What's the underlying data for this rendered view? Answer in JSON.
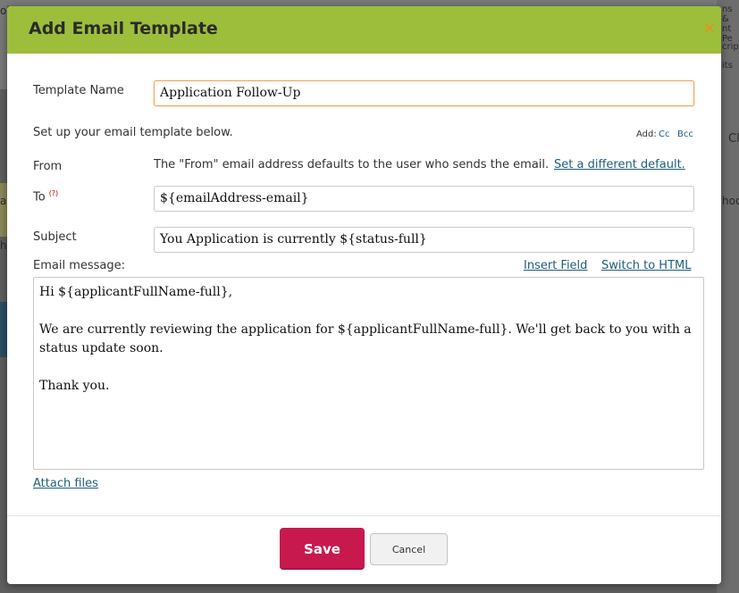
{
  "background": {
    "fragments": [
      "ns &",
      "nt Pe",
      "cript",
      "its",
      "Cl",
      "hoo",
      "ha",
      "al",
      "ol"
    ]
  },
  "dialog": {
    "title": "Add Email Template",
    "close_glyph": "×"
  },
  "form": {
    "template_name_label": "Template Name",
    "template_name_value": "Application Follow-Up",
    "setup_text": "Set up your email template below.",
    "add_label": "Add:",
    "cc_link": "Cc",
    "bcc_link": "Bcc",
    "from_label": "From",
    "from_text": "The \"From\" email address defaults to the user who sends the email.",
    "from_link": "Set a different default.",
    "to_label": "To",
    "to_help": "(?)",
    "to_value": "${emailAddress-email}",
    "subject_label": "Subject",
    "subject_value": "You Application is currently ${status-full}",
    "message_label": "Email message:",
    "insert_field_link": "Insert Field",
    "switch_html_link": "Switch to HTML",
    "message_lines": [
      "Hi ${applicantFullName-full},",
      "",
      "We are currently reviewing the application for ${applicantFullName-full}. We'll get back to you with a status update soon.",
      "",
      "Thank you."
    ],
    "attach_link": "Attach files"
  },
  "buttons": {
    "save": "Save",
    "cancel": "Cancel"
  },
  "colors": {
    "header": "#9dbe3b",
    "save": "#c8194f",
    "link": "#1f5e7b",
    "close": "#f28a1e"
  }
}
